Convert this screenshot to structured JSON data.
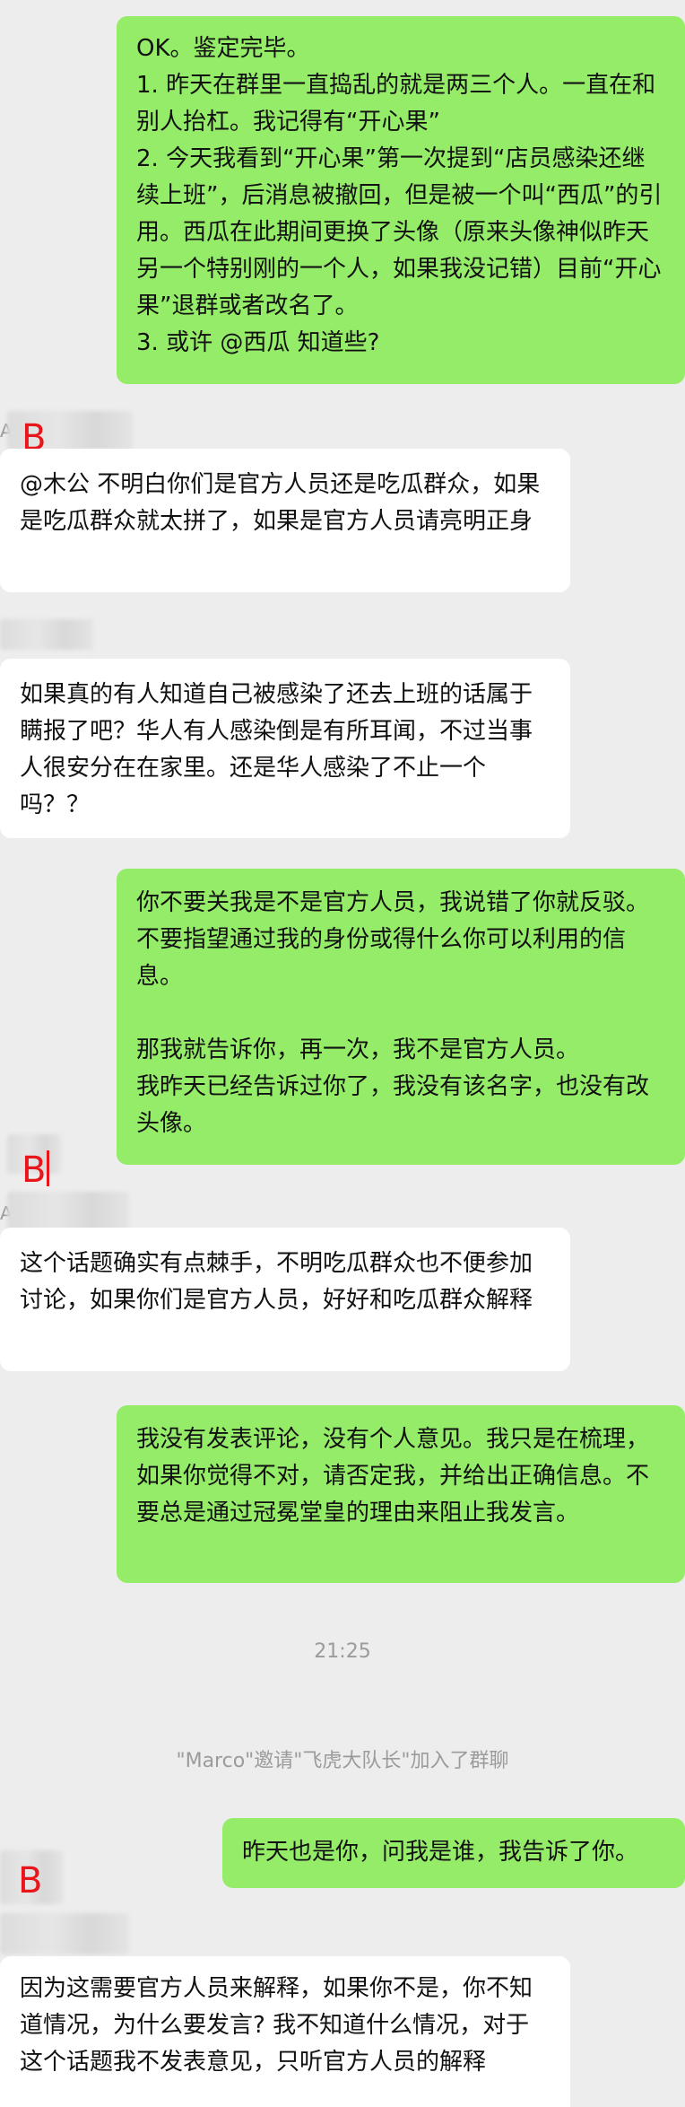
{
  "messages": [
    {
      "side": "out",
      "text": "OK。鉴定完毕。\n1. 昨天在群里一直捣乱的就是两三个人。一直在和别人抬杠。我记得有“开心果”\n2. 今天我看到“开心果”第一次提到“店员感染还继续上班”，后消息被撤回，但是被一个叫“西瓜”的引用。西瓜在此期间更换了头像（原来头像神似昨天另一个特别刚的一个人，如果我没记错）目前“开心果”退群或者改名了。\n3. 或许 @西瓜 知道些?"
    },
    {
      "side": "in",
      "sender_label": "B",
      "sender_name_prefix": "A",
      "text": "@木公 不明白你们是官方人员还是吃瓜群众，如果是吃瓜群众就太拼了，如果是官方人员请亮明正身"
    },
    {
      "side": "in",
      "text": "如果真的有人知道自己被感染了还去上班的话属于瞒报了吧？华人有人感染倒是有所耳闻，不过当事人很安分在在家里。还是华人感染了不止一个吗？？"
    },
    {
      "side": "out",
      "text": "你不要关我是不是官方人员，我说错了你就反驳。不要指望通过我的身份或得什么你可以利用的信息。\n\n那我就告诉你，再一次，我不是官方人员。\n我昨天已经告诉过你了，我没有该名字，也没有改头像。"
    },
    {
      "side": "in",
      "sender_label": "B",
      "sender_name_prefix": "A",
      "text": "这个话题确实有点棘手，不明吃瓜群众也不便参加讨论，如果你们是官方人员，好好和吃瓜群众解释"
    },
    {
      "side": "out",
      "text": "我没有发表评论，没有个人意见。我只是在梳理，如果你觉得不对，请否定我，并给出正确信息。不要总是通过冠冕堂皇的理由来阻止我发言。"
    },
    {
      "side": "out",
      "text": "昨天也是你，问我是谁，我告诉了你。"
    },
    {
      "side": "in",
      "sender_label": "B",
      "text": "因为这需要官方人员来解释，如果你不是，你不知道情况，为什么要发言? 我不知道什么情况，对于这个话题我不发表意见，只听官方人员的解释"
    }
  ],
  "system": {
    "time": "21:25",
    "notice": "\"Marco\"邀请\"飞虎大队长\"加入了群聊"
  }
}
